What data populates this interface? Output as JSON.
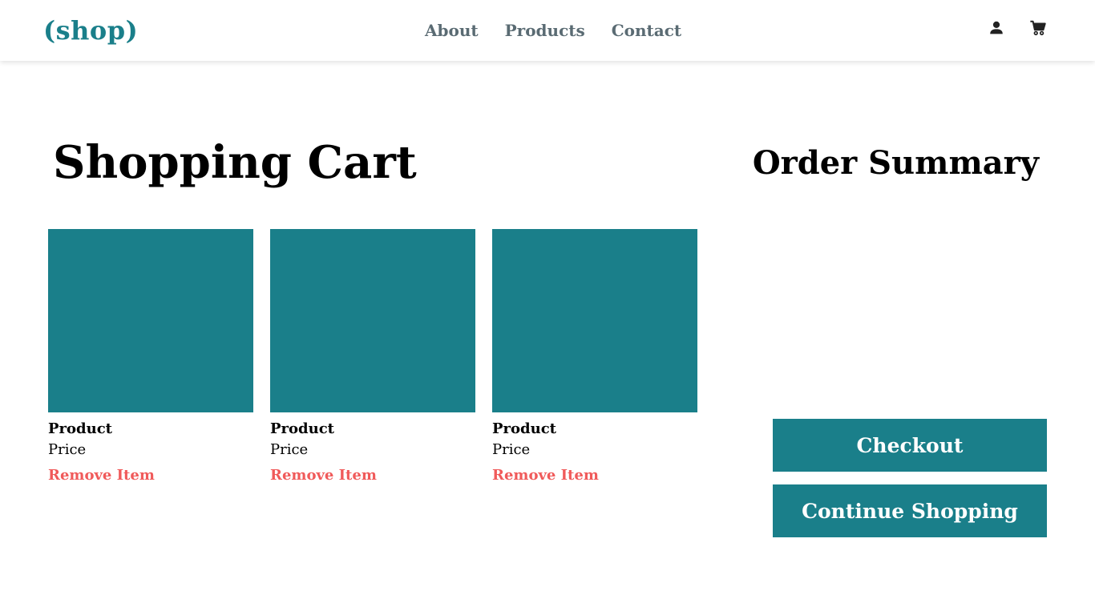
{
  "header": {
    "logo": "(shop)",
    "nav": [
      {
        "label": "About"
      },
      {
        "label": "Products"
      },
      {
        "label": "Contact"
      }
    ],
    "icons": [
      "user-icon",
      "cart-icon"
    ]
  },
  "main": {
    "title": "Shopping Cart",
    "products": [
      {
        "name": "Product",
        "price": "Price",
        "remove_label": "Remove Item"
      },
      {
        "name": "Product",
        "price": "Price",
        "remove_label": "Remove Item"
      },
      {
        "name": "Product",
        "price": "Price",
        "remove_label": "Remove Item"
      }
    ]
  },
  "summary": {
    "title": "Order Summary",
    "checkout_label": "Checkout",
    "continue_label": "Continue Shopping"
  },
  "colors": {
    "accent": "#1a7f8a",
    "remove": "#f05a5a",
    "nav_text": "#5a6b73"
  }
}
